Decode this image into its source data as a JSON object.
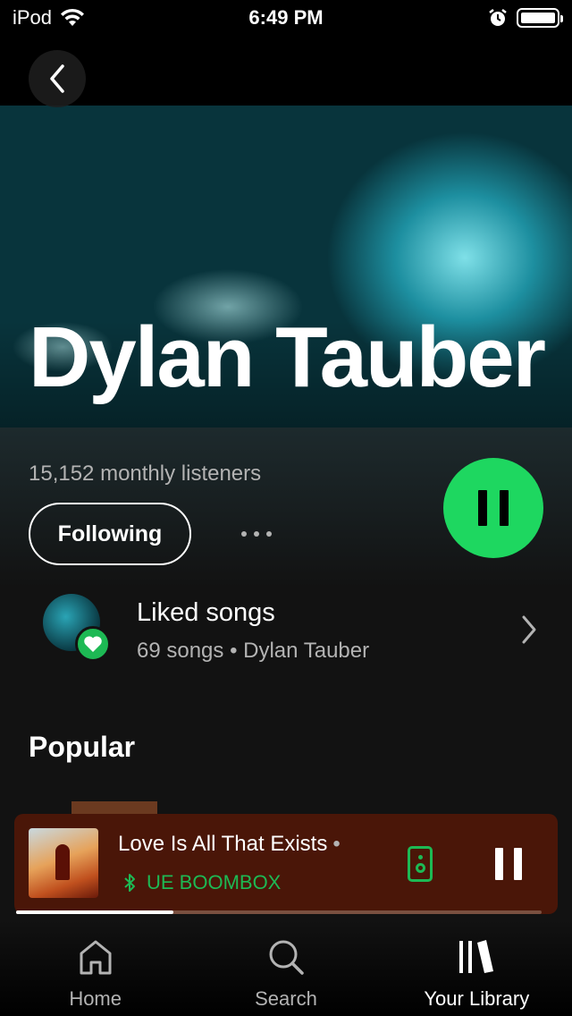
{
  "status_bar": {
    "carrier": "iPod",
    "time": "6:49 PM",
    "icons": [
      "wifi-icon",
      "alarm-icon",
      "battery-icon"
    ]
  },
  "artist": {
    "name": "Dylan Tauber",
    "monthly_listeners": "15,152 monthly listeners",
    "follow_label": "Following",
    "playing": true
  },
  "liked_songs": {
    "title": "Liked songs",
    "subtitle": "69 songs • Dylan Tauber"
  },
  "popular": {
    "title": "Popular"
  },
  "now_playing": {
    "track_title": "Love Is All That Exists",
    "separator": "•",
    "device": "UE BOOMBOX",
    "progress": 0.3,
    "accent_color": "#1db954"
  },
  "bottom_nav": {
    "items": [
      {
        "label": "Home",
        "icon": "home-icon",
        "active": false
      },
      {
        "label": "Search",
        "icon": "search-icon",
        "active": false
      },
      {
        "label": "Your Library",
        "icon": "library-icon",
        "active": true
      }
    ]
  },
  "colors": {
    "brand_green": "#1ed760",
    "background": "#121212",
    "mini_player_bg": "#4a1608"
  }
}
